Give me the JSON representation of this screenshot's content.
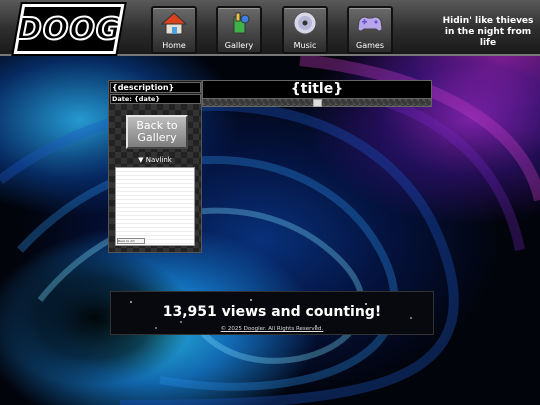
{
  "header": {
    "logo_text": "DOOG",
    "tagline": "Hidin' like thieves in the night from life",
    "nav": [
      {
        "label": "Home",
        "icon": "house-icon"
      },
      {
        "label": "Gallery",
        "icon": "paint-icon"
      },
      {
        "label": "Music",
        "icon": "cd-icon"
      },
      {
        "label": "Games",
        "icon": "gamepad-icon"
      }
    ]
  },
  "sidebar": {
    "description": "{description}",
    "date": "Date: {date}",
    "back_button": "Back to Gallery",
    "navlink": "▼ Navlink",
    "frame_button": "Back to Art"
  },
  "main": {
    "title": "{title}"
  },
  "footer": {
    "views": "13,951 views and counting!",
    "copyright": "© 2025 Doogler. All Rights Reserved."
  },
  "colors": {
    "header": "#3a3a3a",
    "accent_blue": "#28bee6",
    "accent_purple": "#be28a0"
  }
}
